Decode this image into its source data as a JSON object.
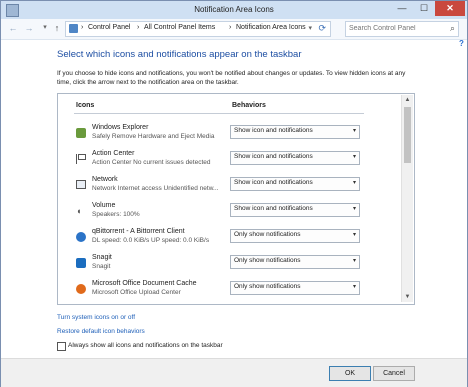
{
  "window": {
    "title": "Notification Area Icons"
  },
  "titlebar_buttons": {
    "minimize": "—",
    "maximize": "☐",
    "close": "✕"
  },
  "nav": {
    "back": "←",
    "forward": "→",
    "recent": "▾",
    "up": "↑"
  },
  "address": {
    "crumbs": [
      "Control Panel",
      "All Control Panel Items",
      "Notification Area Icons"
    ],
    "separator": "›",
    "lead_separator": "›"
  },
  "search": {
    "placeholder": "Search Control Panel"
  },
  "page": {
    "heading": "Select which icons and notifications appear on the taskbar",
    "intro": "If you choose to hide icons and notifications, you won't be notified about changes or updates. To view hidden icons at any time, click the arrow next to the notification area on the taskbar."
  },
  "table": {
    "col_icons": "Icons",
    "col_behaviors": "Behaviors",
    "rows": [
      {
        "name": "Windows Explorer",
        "sub": "Safely Remove Hardware and Eject Media",
        "behavior": "Show icon and notifications",
        "icon": "drive-icon"
      },
      {
        "name": "Action Center",
        "sub": "Action Center  No current issues detected",
        "behavior": "Show icon and notifications",
        "icon": "flag-icon"
      },
      {
        "name": "Network",
        "sub": "Network Internet access  Unidentified netw...",
        "behavior": "Show icon and notifications",
        "icon": "network-icon"
      },
      {
        "name": "Volume",
        "sub": "Speakers: 100%",
        "behavior": "Show icon and notifications",
        "icon": "volume-icon"
      },
      {
        "name": "qBittorrent - A Bittorrent Client",
        "sub": "DL speed: 0.0 KiB/s UP speed: 0.0 KiB/s",
        "behavior": "Only show notifications",
        "icon": "qbittorrent-icon"
      },
      {
        "name": "Snagit",
        "sub": "Snagit",
        "behavior": "Only show notifications",
        "icon": "snagit-icon"
      },
      {
        "name": "Microsoft Office Document Cache",
        "sub": "Microsoft Office Upload Center",
        "behavior": "Only show notifications",
        "icon": "office-upload-icon"
      }
    ]
  },
  "links": {
    "system_icons": "Turn system icons on or off",
    "restore": "Restore default icon behaviors"
  },
  "checkbox": {
    "label": "Always show all icons and notifications on the taskbar",
    "checked": false
  },
  "buttons": {
    "ok": "OK",
    "cancel": "Cancel"
  }
}
